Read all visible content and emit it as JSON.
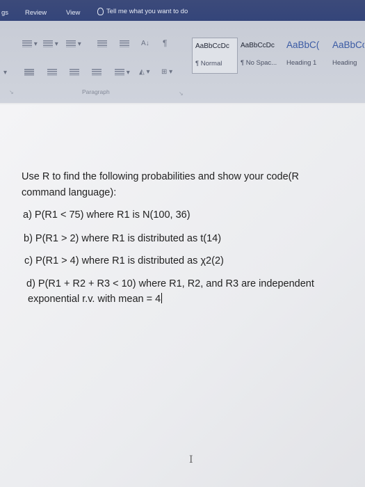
{
  "ribbon": {
    "tabs": [
      "gs",
      "Review",
      "View"
    ],
    "tell_me": "Tell me what you want to do",
    "paragraph_label": "Paragraph",
    "styles": [
      {
        "sample": "AaBbCcDc",
        "name": "¶ Normal"
      },
      {
        "sample": "AaBbCcDc",
        "name": "¶ No Spac..."
      },
      {
        "sample": "AaBbC(",
        "name": "Heading 1"
      },
      {
        "sample": "AaBbCc",
        "name": "Heading"
      }
    ]
  },
  "document": {
    "lines": [
      "Use R to find the following probabilities and show your code(R",
      "command language):",
      "a) P(R1 < 75) where R1 is N(100, 36)",
      "b) P(R1  > 2) where R1 is distributed as t(14)",
      "c) P(R1  > 4) where R1 is distributed as χ2(2)",
      "d) P(R1  + R2 + R3 < 10) where R1, R2, and R3 are independent",
      "exponential r.v. with mean = 4"
    ]
  }
}
